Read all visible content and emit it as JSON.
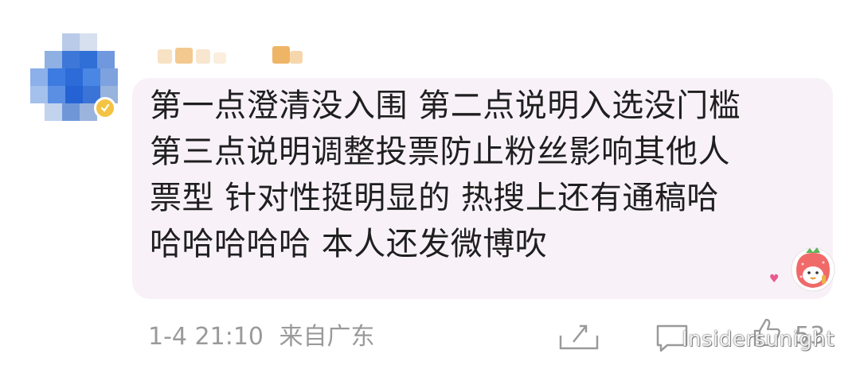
{
  "comment": {
    "text_lines": [
      "第一点澄清没入围 第二点说明入选没门槛",
      "第三点说明调整投票防止粉丝影响其他人",
      "票型 针对性挺明显的 热搜上还有通稿哈",
      "哈哈哈哈哈 本人还发微博吹"
    ],
    "time": "1-4 21:10",
    "location": "来自广东",
    "like_count": "53"
  },
  "icons": {
    "avatar": "avatar-blurred",
    "verified": "verified-badge-icon",
    "sticker": "strawberry-sticker-icon",
    "heart": "heart-icon",
    "reply": "reply-icon",
    "comment": "comment-icon",
    "like": "like-icon"
  },
  "watermark": "Insidersunight",
  "colors": {
    "bubble_bg": "#f8f2f8",
    "text": "#1f1f1f",
    "meta_text": "#9a9a9a",
    "verified": "#f3c343",
    "avatar_blue": "#4a7fd4"
  }
}
